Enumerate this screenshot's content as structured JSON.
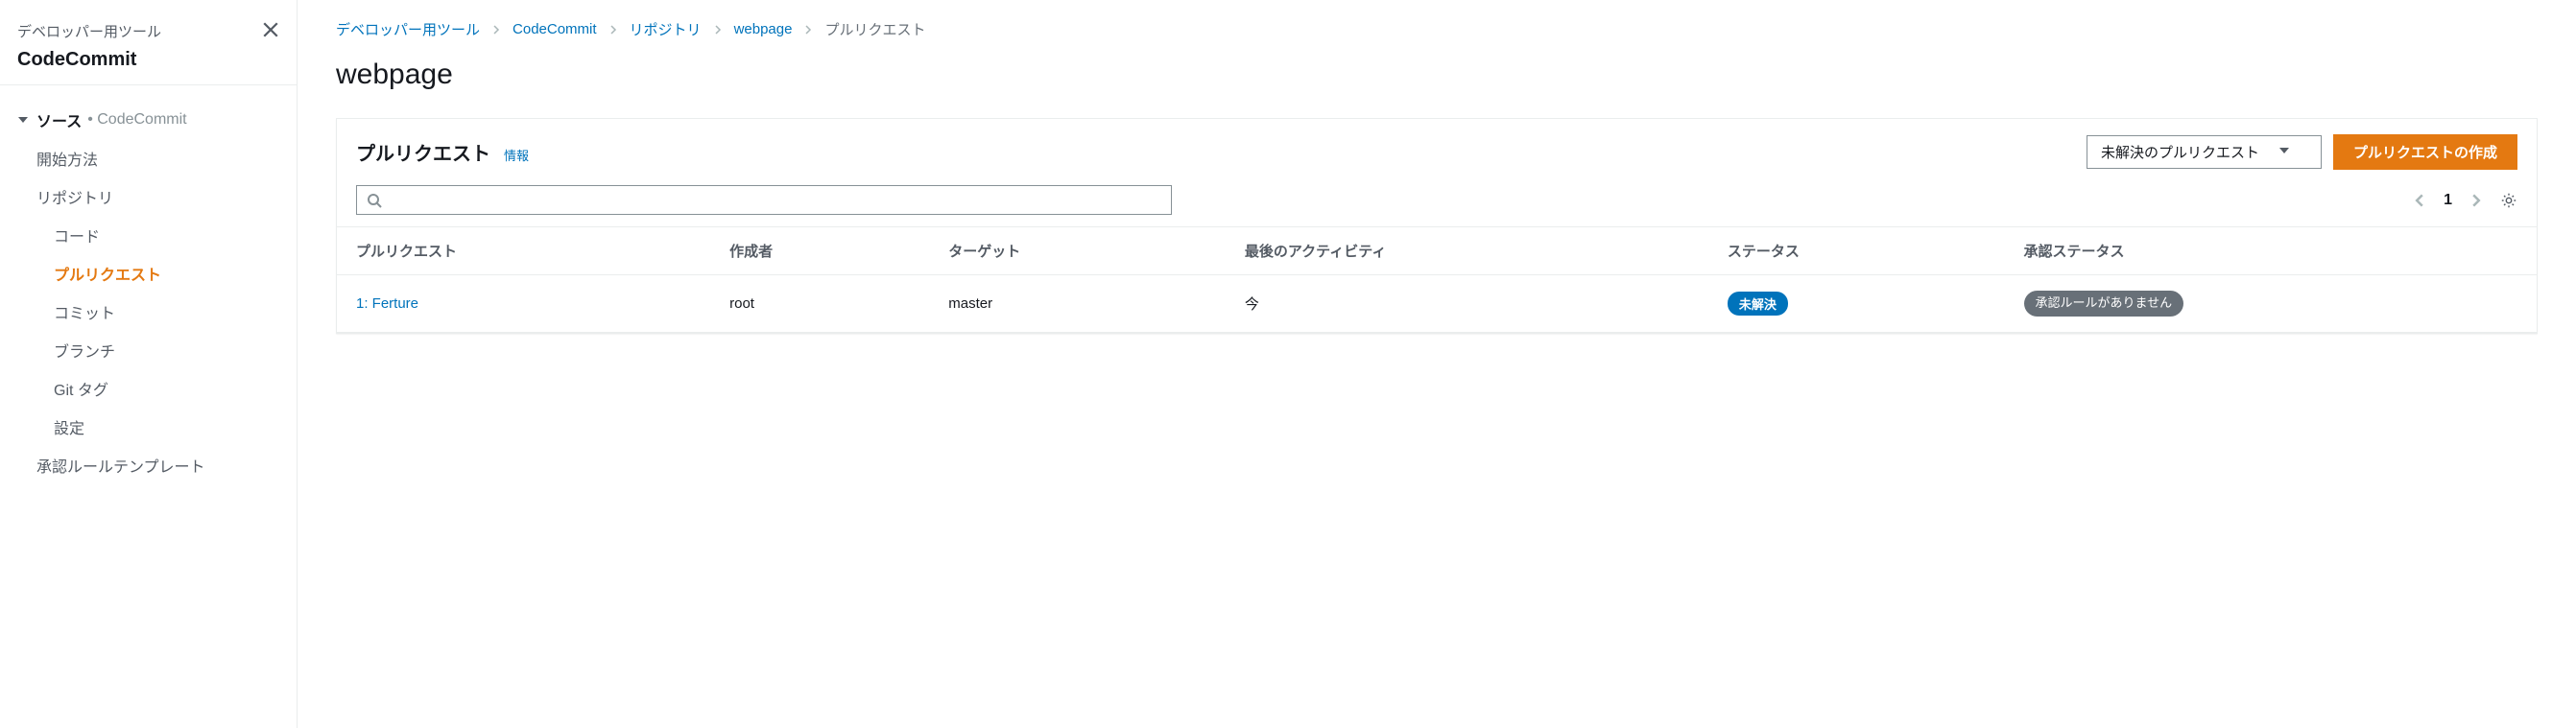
{
  "sidebar": {
    "subtitle": "デベロッパー用ツール",
    "title": "CodeCommit",
    "section": {
      "label": "ソース",
      "sub": "• CodeCommit"
    },
    "items": [
      {
        "label": "開始方法",
        "level": 1,
        "active": false
      },
      {
        "label": "リポジトリ",
        "level": 1,
        "active": false
      },
      {
        "label": "コード",
        "level": 2,
        "active": false
      },
      {
        "label": "プルリクエスト",
        "level": 2,
        "active": true
      },
      {
        "label": "コミット",
        "level": 2,
        "active": false
      },
      {
        "label": "ブランチ",
        "level": 2,
        "active": false
      },
      {
        "label": "Git タグ",
        "level": 2,
        "active": false
      },
      {
        "label": "設定",
        "level": 2,
        "active": false
      },
      {
        "label": "承認ルールテンプレート",
        "level": 1,
        "active": false
      }
    ]
  },
  "breadcrumb": [
    {
      "label": "デベロッパー用ツール",
      "current": false
    },
    {
      "label": "CodeCommit",
      "current": false
    },
    {
      "label": "リポジトリ",
      "current": false
    },
    {
      "label": "webpage",
      "current": false
    },
    {
      "label": "プルリクエスト",
      "current": true
    }
  ],
  "page_title": "webpage",
  "panel": {
    "title": "プルリクエスト",
    "info": "情報",
    "filter_label": "未解決のプルリクエスト",
    "create_button": "プルリクエストの作成",
    "search_placeholder": "",
    "page_number": "1"
  },
  "table": {
    "headers": [
      "プルリクエスト",
      "作成者",
      "ターゲット",
      "最後のアクティビティ",
      "ステータス",
      "承認ステータス"
    ],
    "rows": [
      {
        "pr": "1: Ferture",
        "author": "root",
        "target": "master",
        "activity": "今",
        "status": "未解決",
        "approval": "承認ルールがありません"
      }
    ]
  }
}
